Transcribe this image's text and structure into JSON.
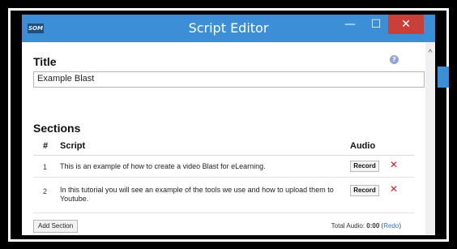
{
  "window": {
    "title": "Script Editor",
    "logo_text": "SOM",
    "minimize": "—",
    "maximize": "☐",
    "close": "✕"
  },
  "title_section": {
    "label": "Title",
    "value": "Example Blast",
    "help": "?"
  },
  "sections": {
    "label": "Sections",
    "columns": {
      "num": "#",
      "script": "Script",
      "audio": "Audio"
    },
    "rows": [
      {
        "num": "1",
        "script": "This is an example of how to create a video Blast for eLearning.",
        "record_label": "Record",
        "delete": "✕"
      },
      {
        "num": "2",
        "script": "In this tutorial you will see an example of the tools we use and how to upload them to Youtube.",
        "record_label": "Record",
        "delete": "✕"
      }
    ]
  },
  "footer": {
    "add_section_label": "Add Section",
    "total_audio_label": "Total Audio:",
    "total_audio_value": "0:00",
    "redo_open": "(",
    "redo_label": "Redo",
    "redo_close": ")"
  },
  "scroll": {
    "up_arrow": "^"
  },
  "colors": {
    "titlebar": "#3c8fd6",
    "close": "#c9403a",
    "delete": "#d62020",
    "link": "#2f74c0"
  }
}
